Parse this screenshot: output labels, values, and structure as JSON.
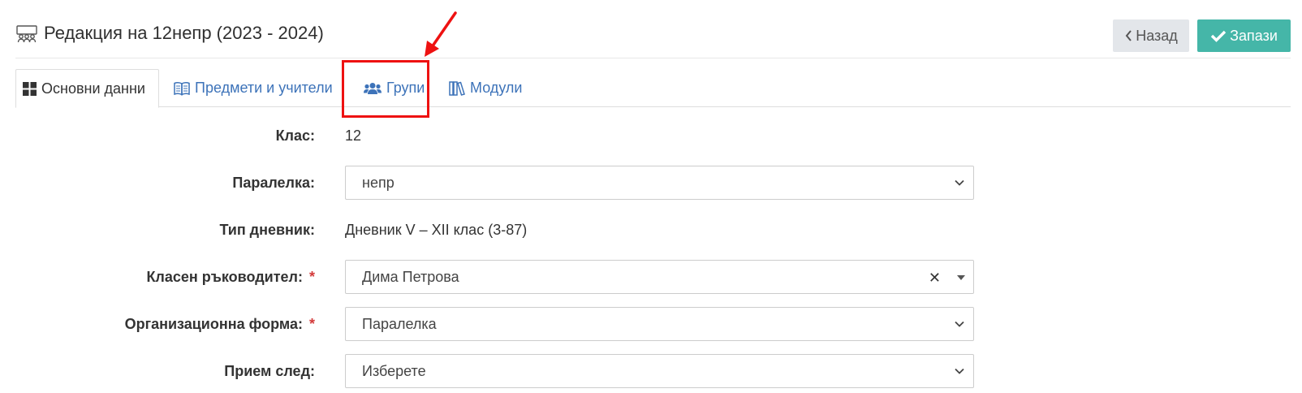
{
  "header": {
    "title": "Редакция на 12непр (2023 - 2024)",
    "title_icon": "users-outline-icon",
    "back_label": "Назад",
    "save_label": "Запази"
  },
  "tabs": [
    {
      "label": "Основни данни",
      "icon": "grid-icon",
      "active": true
    },
    {
      "label": "Предмети и учители",
      "icon": "book-open-icon",
      "active": false
    },
    {
      "label": "Групи",
      "icon": "users-icon",
      "active": false,
      "highlighted": true
    },
    {
      "label": "Модули",
      "icon": "books-icon",
      "active": false
    }
  ],
  "form": {
    "class": {
      "label": "Клас:",
      "value": "12"
    },
    "section": {
      "label": "Паралелка:",
      "value": "непр"
    },
    "diary_type": {
      "label": "Тип дневник:",
      "value": "Дневник V – XII клас (3-87)"
    },
    "class_teacher": {
      "label": "Класен ръководител:",
      "required_mark": "*",
      "value": "Дима Петрова",
      "clear_glyph": "✕"
    },
    "org_form": {
      "label": "Организационна форма:",
      "required_mark": "*",
      "value": "Паралелка"
    },
    "admission_after": {
      "label": "Прием след:",
      "value": "Изберете"
    }
  },
  "colors": {
    "link": "#3d73b9",
    "save_button": "#45b6a8",
    "back_button": "#e3e6ea",
    "required": "#d33a3a",
    "annotation": "#ee1111"
  }
}
